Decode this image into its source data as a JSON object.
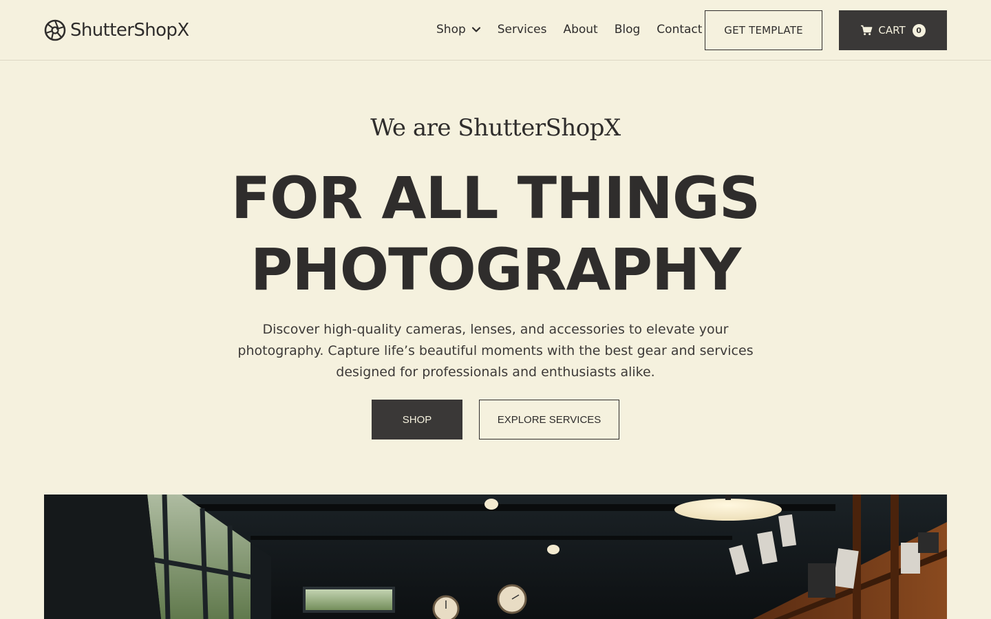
{
  "header": {
    "logo_text": "ShutterShopX",
    "logo_icon": "camera-aperture-icon",
    "nav": [
      {
        "label": "Shop",
        "has_dropdown": true
      },
      {
        "label": "Services"
      },
      {
        "label": "About"
      },
      {
        "label": "Blog"
      },
      {
        "label": "Contact"
      }
    ],
    "template_button": "GET TEMPLATE",
    "cart_button": "CART",
    "cart_count": "0",
    "cart_icon": "shopping-cart-icon"
  },
  "hero": {
    "eyebrow": "We are ShutterShopX",
    "headline_line1": "FOR ALL THINGS",
    "headline_line2": "PHOTOGRAPHY",
    "description": "Discover high-quality cameras, lenses, and accessories to elevate your photography. Capture life’s beautiful moments with the best gear and services designed for professionals and enthusiasts alike.",
    "shop_button": "SHOP",
    "explore_button": "EXPLORE SERVICES"
  },
  "colors": {
    "background": "#f5f1de",
    "text": "#2f2d2c",
    "dark_button": "#3a3837"
  }
}
